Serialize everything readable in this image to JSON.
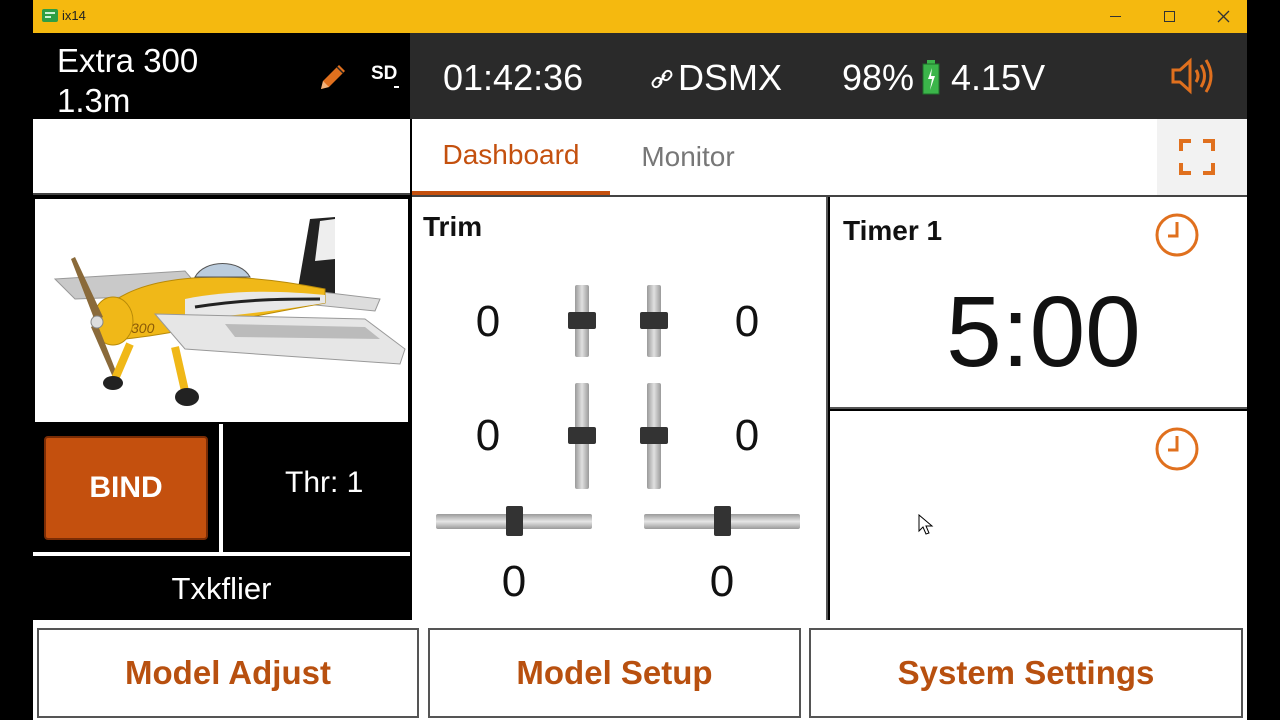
{
  "window": {
    "title": "ix14"
  },
  "header": {
    "model_name": "Extra 300\n1.3m",
    "sd_label": "SD",
    "clock": "01:42:36",
    "protocol": "DSMX",
    "battery_percent": "98%",
    "voltage": "4.15V"
  },
  "left": {
    "bind_label": "BIND",
    "throttle_label": "Thr: 1",
    "user_name": "Txkflier"
  },
  "tabs": [
    {
      "label": "Dashboard",
      "active": true
    },
    {
      "label": "Monitor",
      "active": false
    }
  ],
  "trim": {
    "title": "Trim",
    "left_upper": "0",
    "right_upper": "0",
    "left_lower": "0",
    "right_lower": "0",
    "bottom_left": "0",
    "bottom_right": "0"
  },
  "timer1": {
    "title": "Timer 1",
    "value": "5:00"
  },
  "bottom_buttons": {
    "model_adjust": "Model Adjust",
    "model_setup": "Model Setup",
    "system_settings": "System Settings"
  },
  "colors": {
    "accent": "#c4500e",
    "title_bar": "#f5b90f",
    "status_bar": "#2a2a2a",
    "battery": "#3bb54a"
  }
}
